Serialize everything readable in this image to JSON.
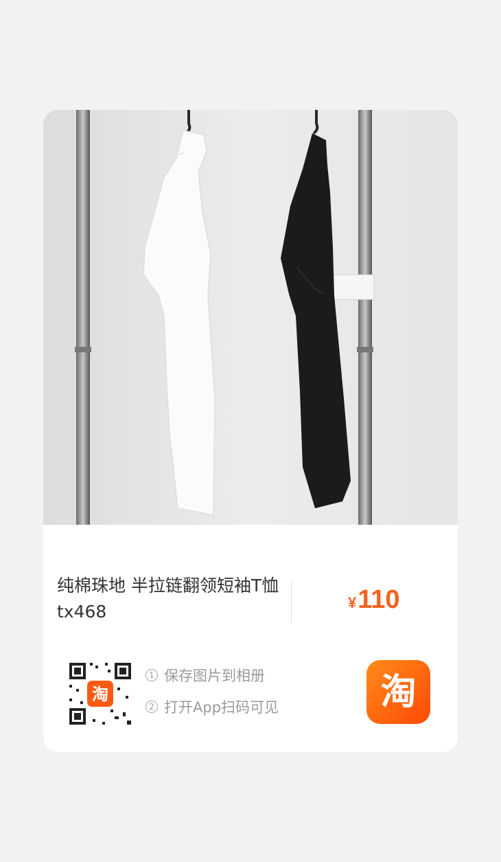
{
  "product": {
    "image_icon": "product-photo-shirts-on-rack",
    "title": "纯棉珠地 半拉链翻领短袖T恤 tx468",
    "price_currency": "¥",
    "price_value": "110"
  },
  "share": {
    "qr_icon": "qr-code-icon",
    "steps": [
      {
        "num": "1",
        "text": "保存图片到相册"
      },
      {
        "num": "2",
        "text": "打开App扫码可见"
      }
    ],
    "app_logo_text": "淘",
    "app_logo_icon": "taobao-logo-icon"
  },
  "colors": {
    "accent": "#f2631f",
    "logo_gradient_start": "#ff8b18",
    "logo_gradient_end": "#ff4a08"
  }
}
